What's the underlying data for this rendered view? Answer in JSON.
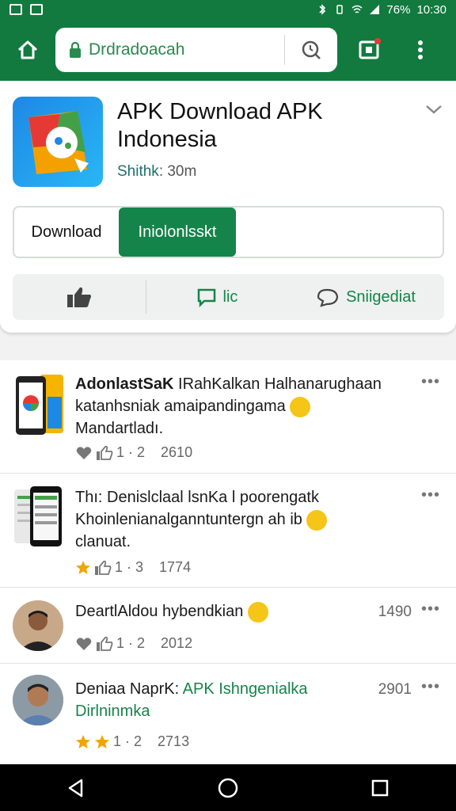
{
  "status_bar": {
    "battery": "76%",
    "time": "10:30"
  },
  "toolbar": {
    "url": "Drdradoacah"
  },
  "app": {
    "title": "APK Download APK Indonesia",
    "meta_key": "Shithk",
    "meta_value": ": 30m",
    "download_label": "Download",
    "install_label": "Iniolonlsskt",
    "comment_label": "lic",
    "share_label": "Sniigediat"
  },
  "posts": [
    {
      "line1_bold": "AdonlastSaK",
      "line1_rest": " IRahKalkan Halhanarughaan",
      "line2": "katanhsniak amaipandingama",
      "line3": "Mandartladı.",
      "stat_count": "1 · 2",
      "stat_value": "2610"
    },
    {
      "line1": "Thı: Denislclaal lsnKa l poorengatk",
      "line2": "Khoinlenianalganntuntergn ah ib",
      "line3": "clanuat.",
      "stat_count": "1 · 3",
      "stat_value": "1774"
    },
    {
      "line1": "DeartlAldou hybendkian",
      "number": "1490",
      "stat_count": "1 · 2",
      "stat_value": "2012"
    },
    {
      "line1_black": "Deniaa NaprK:",
      "line1_green": " APK Ishngenialka",
      "line2_green": "Dirlninmka",
      "number": "2901",
      "stat_count": "1 · 2",
      "stat_value": "2713"
    }
  ],
  "more_label": "•••",
  "colors": {
    "brand_green": "#127a3e",
    "button_green": "#15844a",
    "star": "#f0a500"
  }
}
